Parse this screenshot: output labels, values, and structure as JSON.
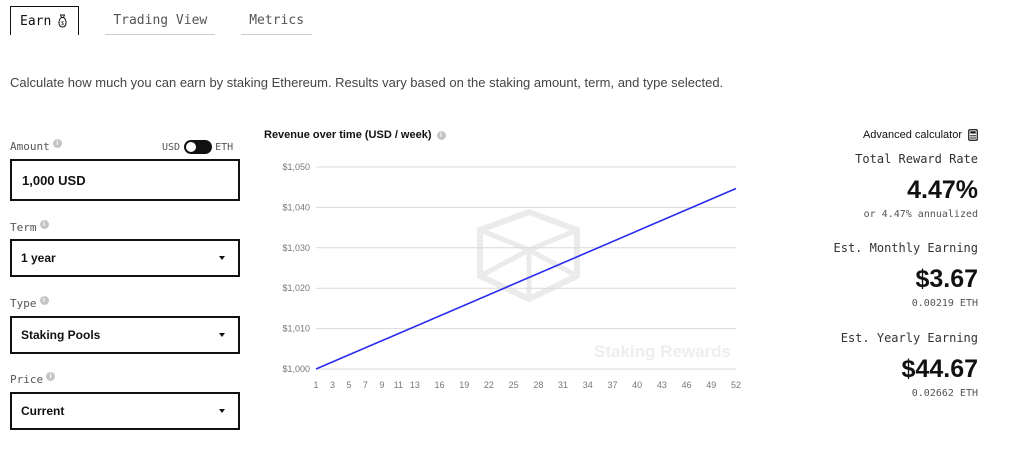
{
  "tabs": [
    {
      "label": "Earn",
      "active": true,
      "icon": "money-bag-icon"
    },
    {
      "label": "Trading View",
      "active": false
    },
    {
      "label": "Metrics",
      "active": false
    }
  ],
  "intro": "Calculate how much you can earn by staking Ethereum. Results vary based on the staking amount, term, and type selected.",
  "form": {
    "amount": {
      "label": "Amount",
      "value": "1,000 USD"
    },
    "currency_toggle": {
      "left": "USD",
      "right": "ETH"
    },
    "term": {
      "label": "Term",
      "value": "1 year"
    },
    "type": {
      "label": "Type",
      "value": "Staking Pools"
    },
    "price": {
      "label": "Price",
      "value": "Current"
    }
  },
  "chart_data": {
    "type": "line",
    "title": "Revenue over time (USD / week)",
    "watermark": "Staking Rewards",
    "x": [
      1,
      3,
      5,
      7,
      9,
      11,
      13,
      16,
      19,
      22,
      25,
      28,
      31,
      34,
      37,
      40,
      43,
      46,
      49,
      52
    ],
    "ylim": [
      1000,
      1050
    ],
    "y_ticks": [
      "$1,000",
      "$1,010",
      "$1,020",
      "$1,030",
      "$1,040",
      "$1,050"
    ],
    "series": [
      {
        "color": "#2b2bf0",
        "points": [
          [
            1,
            1000
          ],
          [
            52,
            1044.67
          ]
        ]
      }
    ],
    "grid": true
  },
  "right": {
    "advanced_label": "Advanced calculator",
    "total_reward_label": "Total Reward Rate",
    "total_reward_value": "4.47%",
    "total_reward_sub": "or 4.47% annualized",
    "monthly_label": "Est. Monthly Earning",
    "monthly_value": "$3.67",
    "monthly_sub": "0.00219 ETH",
    "yearly_label": "Est. Yearly Earning",
    "yearly_value": "$44.67",
    "yearly_sub": "0.02662 ETH"
  }
}
